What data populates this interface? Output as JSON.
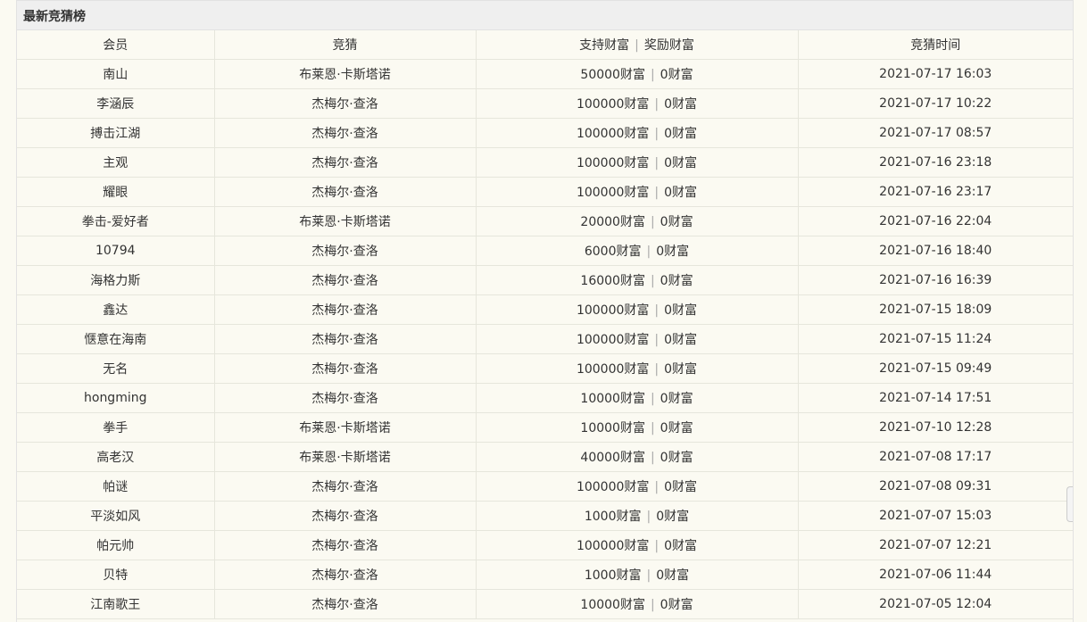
{
  "panel": {
    "title": "最新竞猜榜"
  },
  "columns": {
    "member": "会员",
    "guess": "竞猜",
    "support": "支持财富",
    "reward": "奖励财富",
    "time": "竞猜时间"
  },
  "separator": "|",
  "rows": [
    {
      "member": "南山",
      "guess": "布莱恩·卡斯塔诺",
      "support": "50000财富",
      "reward": "0财富",
      "time": "2021-07-17 16:03"
    },
    {
      "member": "李涵辰",
      "guess": "杰梅尔·查洛",
      "support": "100000财富",
      "reward": "0财富",
      "time": "2021-07-17 10:22"
    },
    {
      "member": "搏击江湖",
      "guess": "杰梅尔·查洛",
      "support": "100000财富",
      "reward": "0财富",
      "time": "2021-07-17 08:57"
    },
    {
      "member": "主观",
      "guess": "杰梅尔·查洛",
      "support": "100000财富",
      "reward": "0财富",
      "time": "2021-07-16 23:18"
    },
    {
      "member": "耀眼",
      "guess": "杰梅尔·查洛",
      "support": "100000财富",
      "reward": "0财富",
      "time": "2021-07-16 23:17"
    },
    {
      "member": "拳击-爱好者",
      "guess": "布莱恩·卡斯塔诺",
      "support": "20000财富",
      "reward": "0财富",
      "time": "2021-07-16 22:04"
    },
    {
      "member": "10794",
      "guess": "杰梅尔·查洛",
      "support": "6000财富",
      "reward": "0财富",
      "time": "2021-07-16 18:40"
    },
    {
      "member": "海格力斯",
      "guess": "杰梅尔·查洛",
      "support": "16000财富",
      "reward": "0财富",
      "time": "2021-07-16 16:39"
    },
    {
      "member": "鑫达",
      "guess": "杰梅尔·查洛",
      "support": "100000财富",
      "reward": "0财富",
      "time": "2021-07-15 18:09"
    },
    {
      "member": "惬意在海南",
      "guess": "杰梅尔·查洛",
      "support": "100000财富",
      "reward": "0财富",
      "time": "2021-07-15 11:24"
    },
    {
      "member": "无名",
      "guess": "杰梅尔·查洛",
      "support": "100000财富",
      "reward": "0财富",
      "time": "2021-07-15 09:49"
    },
    {
      "member": "hongming",
      "guess": "杰梅尔·查洛",
      "support": "10000财富",
      "reward": "0财富",
      "time": "2021-07-14 17:51"
    },
    {
      "member": "拳手",
      "guess": "布莱恩·卡斯塔诺",
      "support": "10000财富",
      "reward": "0财富",
      "time": "2021-07-10 12:28"
    },
    {
      "member": "高老汉",
      "guess": "布莱恩·卡斯塔诺",
      "support": "40000财富",
      "reward": "0财富",
      "time": "2021-07-08 17:17"
    },
    {
      "member": "帕谜",
      "guess": "杰梅尔·查洛",
      "support": "100000财富",
      "reward": "0财富",
      "time": "2021-07-08 09:31"
    },
    {
      "member": "平淡如风",
      "guess": "杰梅尔·查洛",
      "support": "1000财富",
      "reward": "0财富",
      "time": "2021-07-07 15:03"
    },
    {
      "member": "帕元帅",
      "guess": "杰梅尔·查洛",
      "support": "100000财富",
      "reward": "0财富",
      "time": "2021-07-07 12:21"
    },
    {
      "member": "贝特",
      "guess": "杰梅尔·查洛",
      "support": "1000财富",
      "reward": "0财富",
      "time": "2021-07-06 11:44"
    },
    {
      "member": "江南歌王",
      "guess": "杰梅尔·查洛",
      "support": "10000财富",
      "reward": "0财富",
      "time": "2021-07-05 12:04"
    }
  ]
}
